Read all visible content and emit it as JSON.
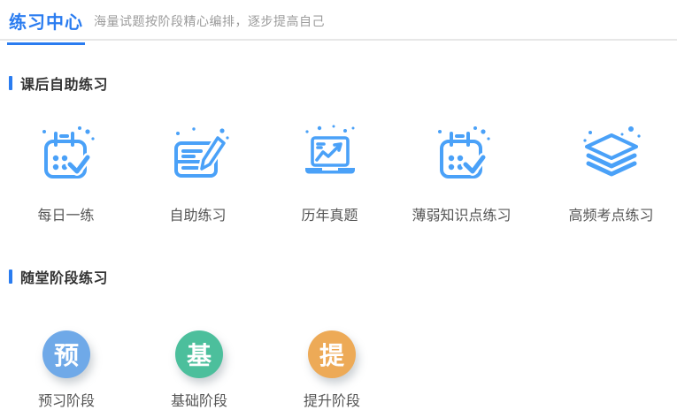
{
  "header": {
    "title": "练习中心",
    "subtitle": "海量试题按阶段精心编排，逐步提高自己"
  },
  "sections": [
    {
      "title": "课后自助练习",
      "items": [
        {
          "id": "daily-practice",
          "label": "每日一练",
          "icon": "calendar-check-icon"
        },
        {
          "id": "self-practice",
          "label": "自助练习",
          "icon": "edit-note-icon"
        },
        {
          "id": "past-exam-papers",
          "label": "历年真题",
          "icon": "laptop-chart-icon"
        },
        {
          "id": "weak-knowledge-points",
          "label": "薄弱知识点练习",
          "icon": "calendar-check-icon"
        },
        {
          "id": "high-frequency-points",
          "label": "高频考点练习",
          "icon": "layers-icon"
        }
      ]
    },
    {
      "title": "随堂阶段练习",
      "items": [
        {
          "id": "preview-stage",
          "label": "预习阶段",
          "badge": "预",
          "color": "#6fa9e8"
        },
        {
          "id": "basic-stage",
          "label": "基础阶段",
          "badge": "基",
          "color": "#4cbf9c"
        },
        {
          "id": "improve-stage",
          "label": "提升阶段",
          "badge": "提",
          "color": "#edaa57"
        }
      ]
    }
  ],
  "colors": {
    "accent_blue": "#2a7cf0",
    "icon_blue": "#4aa1f8",
    "text_dark": "#333333",
    "text_gray": "#555555",
    "subtitle_gray": "#9b9b9b",
    "divider": "#e7e7e7"
  }
}
